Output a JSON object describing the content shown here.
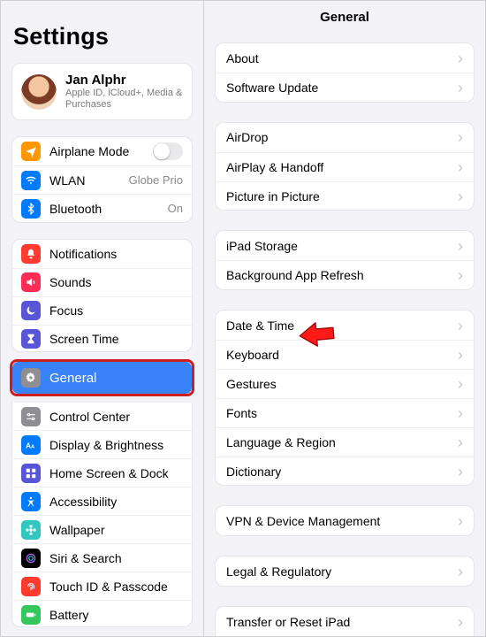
{
  "left": {
    "title": "Settings",
    "profile": {
      "name": "Jan Alphr",
      "sub": "Apple ID, iCloud+, Media & Purchases"
    },
    "group1": {
      "airplane": "Airplane Mode",
      "wlan": "WLAN",
      "wlan_detail": "Globe Prio",
      "bt": "Bluetooth",
      "bt_detail": "On"
    },
    "group2": {
      "notifications": "Notifications",
      "sounds": "Sounds",
      "focus": "Focus",
      "screentime": "Screen Time"
    },
    "group3": {
      "general": "General",
      "control": "Control Center",
      "display": "Display & Brightness",
      "home": "Home Screen & Dock",
      "access": "Accessibility",
      "wallpaper": "Wallpaper",
      "siri": "Siri & Search",
      "touchid": "Touch ID & Passcode",
      "battery": "Battery"
    }
  },
  "right": {
    "title": "General",
    "g1": {
      "about": "About",
      "update": "Software Update"
    },
    "g2": {
      "airdrop": "AirDrop",
      "airplay": "AirPlay & Handoff",
      "pip": "Picture in Picture"
    },
    "g3": {
      "storage": "iPad Storage",
      "bar": "Background App Refresh"
    },
    "g4": {
      "date": "Date & Time",
      "keyboard": "Keyboard",
      "gestures": "Gestures",
      "fonts": "Fonts",
      "lang": "Language & Region",
      "dict": "Dictionary"
    },
    "g5": {
      "vpn": "VPN & Device Management"
    },
    "g6": {
      "legal": "Legal & Regulatory"
    },
    "g7": {
      "reset": "Transfer or Reset iPad"
    }
  }
}
